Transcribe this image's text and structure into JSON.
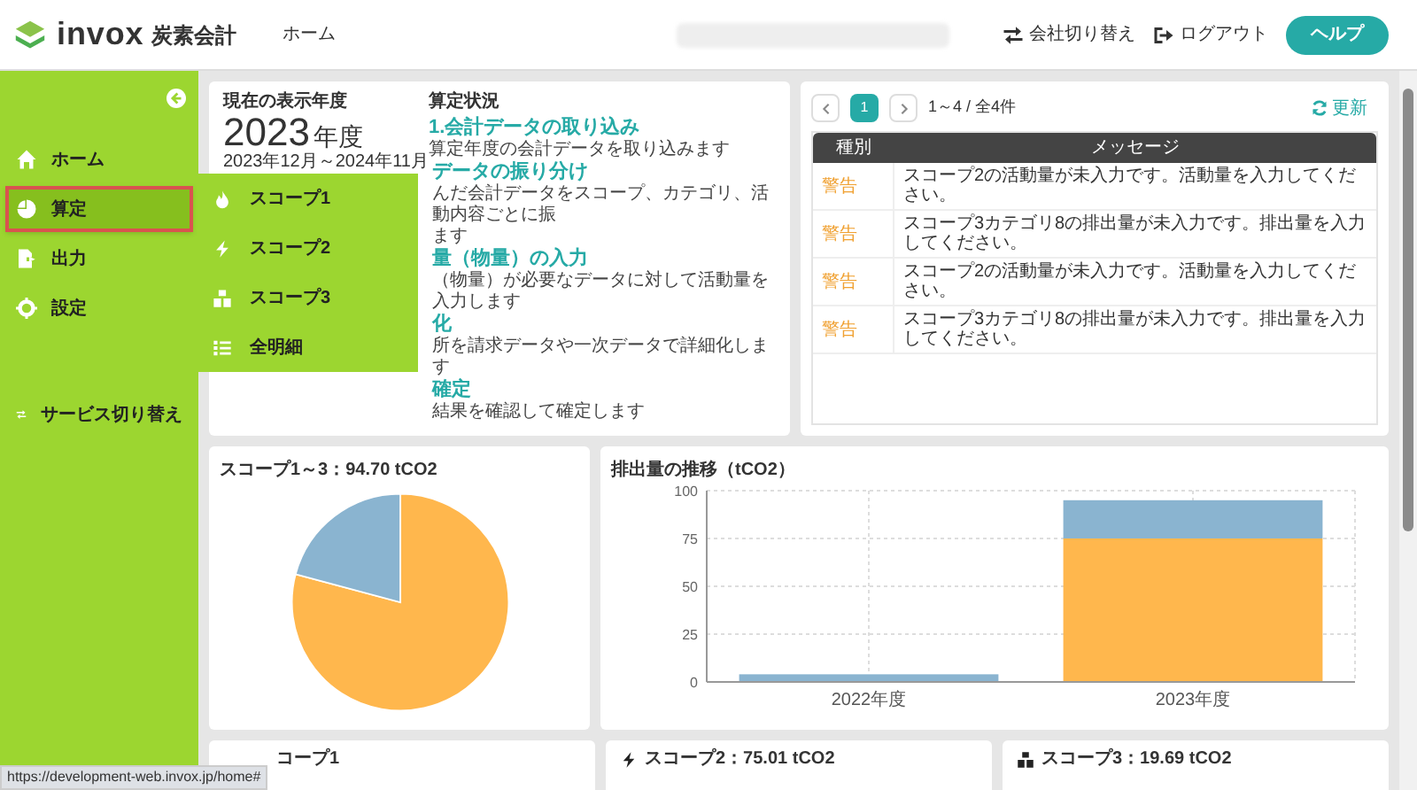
{
  "header": {
    "logo_text": "invox",
    "logo_subtitle": "炭素会計",
    "nav": [
      "ホーム"
    ],
    "actions": [
      {
        "kind": "switch",
        "label": "会社切り替え"
      },
      {
        "kind": "logout",
        "label": "ログアウト"
      }
    ],
    "help_button": "ヘルプ"
  },
  "sidebar": {
    "items": [
      {
        "label": "ホーム",
        "selected": false
      },
      {
        "label": "算定",
        "selected": true
      },
      {
        "label": "出力",
        "selected": false
      },
      {
        "label": "設定",
        "selected": false
      }
    ],
    "service_switch": "サービス切り替え"
  },
  "submenu": {
    "items": [
      {
        "label": "スコープ1"
      },
      {
        "label": "スコープ2"
      },
      {
        "label": "スコープ3"
      },
      {
        "label": "全明細"
      }
    ]
  },
  "year_panel": {
    "label": "現在の表示年度",
    "year": "2023",
    "year_suffix": "年度",
    "period": "2023年12月～2024年11月"
  },
  "status": {
    "heading": "算定状況",
    "steps": [
      {
        "title": "1.会計データの取り込み",
        "lines": [
          "算定年度の会計データを取り込みます"
        ]
      },
      {
        "title": "データの振り分け",
        "lines": [
          "んだ会計データをスコープ、カテゴリ、活動内容ごとに振",
          "ます"
        ]
      },
      {
        "title": "量（物量）の入力",
        "lines": [
          "（物量）が必要なデータに対して活動量を入力します"
        ]
      },
      {
        "title": "化",
        "lines": [
          "所を請求データや一次データで詳細化します"
        ]
      },
      {
        "title": "確定",
        "lines": [
          "結果を確認して確定します"
        ]
      }
    ]
  },
  "messages": {
    "pages": [
      {
        "label": "1",
        "selected": true
      }
    ],
    "range": "1～4 / 全4件",
    "refresh": "更新",
    "columns": [
      "種別",
      "メッセージ"
    ],
    "rows": [
      {
        "type": "警告",
        "message": "スコープ2の活動量が未入力です。活動量を入力してください。"
      },
      {
        "type": "警告",
        "message": "スコープ3カテゴリ8の排出量が未入力です。排出量を入力してください。"
      },
      {
        "type": "警告",
        "message": "スコープ2の活動量が未入力です。活動量を入力してください。"
      },
      {
        "type": "警告",
        "message": "スコープ3カテゴリ8の排出量が未入力です。排出量を入力してください。"
      }
    ]
  },
  "pie_card": {
    "title": "スコープ1～3：94.70 tCO2"
  },
  "bar_card": {
    "chart_data": {
      "type": "bar",
      "title": "排出量の推移（tCO2）",
      "categories": [
        "2022年度",
        "2023年度"
      ],
      "stacked": true,
      "grid": true,
      "ylim": [
        0,
        100
      ],
      "yticks": [
        0,
        25,
        50,
        75,
        100
      ],
      "series": [
        {
          "color": "#ffb74d",
          "values": [
            0,
            75
          ]
        },
        {
          "color": "#8ab4d0",
          "values": [
            4,
            20
          ]
        }
      ]
    }
  },
  "scope_cards": [
    {
      "title": "コープ1"
    },
    {
      "title": "スコープ2：75.01 tCO2"
    },
    {
      "title": "スコープ3：19.69 tCO2"
    }
  ],
  "status_url": "https://development-web.invox.jp/home#"
}
